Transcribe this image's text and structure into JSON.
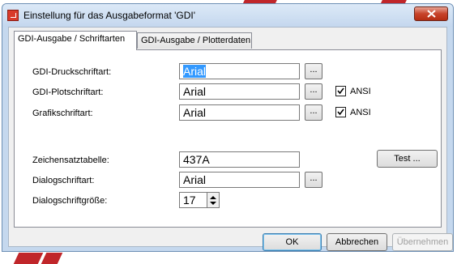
{
  "window": {
    "title": "Einstellung für das Ausgabeformat 'GDI'"
  },
  "tabs": [
    {
      "label": "GDI-Ausgabe / Schriftarten",
      "active": true
    },
    {
      "label": "GDI-Ausgabe / Plotterdaten",
      "active": false
    }
  ],
  "form": {
    "druckschrift": {
      "label": "GDI-Druckschriftart:",
      "value": "Arial",
      "browse": "..."
    },
    "plotschrift": {
      "label": "GDI-Plotschriftart:",
      "value": "Arial",
      "browse": "...",
      "ansi_label": "ANSI",
      "ansi_checked": true
    },
    "grafikschrift": {
      "label": "Grafikschriftart:",
      "value": "Arial",
      "browse": "...",
      "ansi_label": "ANSI",
      "ansi_checked": true
    },
    "zeichensatz": {
      "label": "Zeichensatztabelle:",
      "value": "437A",
      "test_button": "Test ..."
    },
    "dialogschrift": {
      "label": "Dialogschriftart:",
      "value": "Arial",
      "browse": "..."
    },
    "dialoggroesse": {
      "label": "Dialogschriftgröße:",
      "value": "17"
    }
  },
  "buttons": {
    "ok": "OK",
    "cancel": "Abbrechen",
    "apply": "Übernehmen"
  },
  "colors": {
    "frame": "#c5d8ee",
    "selection": "#3399ff",
    "close": "#c7432a"
  }
}
